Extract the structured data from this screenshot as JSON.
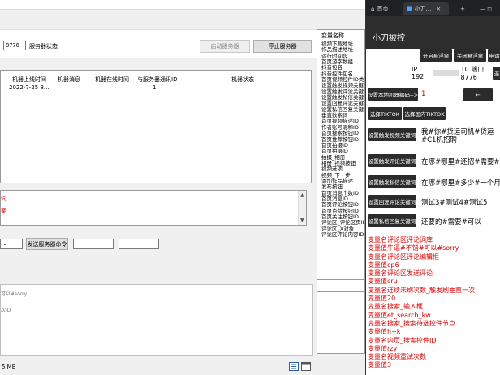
{
  "desktop": {
    "top_tabs": [
      "",
      "",
      ""
    ],
    "port_value": "8776",
    "server_status_label": "服务器状态",
    "start_server": "启动服务器",
    "stop_server": "停止服务器",
    "table": {
      "headers": [
        "机器上线时间",
        "机器消息",
        "机器在线时间",
        "与服务器通讯ID",
        "机器状态"
      ],
      "rows": [
        [
          "2022-7-25 8...",
          "",
          "",
          "1",
          ""
        ]
      ]
    },
    "log_lines": [
      "伺",
      "案"
    ],
    "send_command": "发送服务器命令",
    "bottom_text_1": "可以#sorry",
    "bottom_text_2": "次ID",
    "status_size": "5 MB"
  },
  "varlist": {
    "header": "变量名称",
    "items": [
      "视频下载地址",
      "作品描述地址",
      "运行时间段",
      "首页游字数组",
      "抖音包名",
      "抖音控件包名",
      "首页视频控件ID类",
      "设置触发视频关键",
      "设置触发评论关键",
      "设置触发私信关键",
      "设置回复评论关键",
      "设置私信回复关键",
      "垂直数索词",
      "首页视频描述ID",
      "作者账号昵称ID",
      "首页搜索按钮ID",
      "首页推荐按钮ID",
      "首页拍摄ID",
      "首页拍摄ID",
      "拍摄_相册",
      "相册_视频按钮",
      "视频选项",
      "视频_下一步",
      "添加作品描述",
      "发布按钮",
      "首页消息个数ID",
      "首页消息ID",
      "首页评论按钮ID",
      "首页点赞按钮ID",
      "首页关注按钮ID",
      "评论区_评论区页ID",
      "评论区_X对象",
      "评论区评论内容ID"
    ]
  },
  "phone": {
    "chrome_tabs": [
      "首页",
      "小刀...",
      "×"
    ],
    "app_title": "小刀被控",
    "buttons_row1": [
      "开启悬浮窗",
      "关闭悬浮窗",
      "申请"
    ],
    "ip_prefix": "IP 192",
    "ip_suffix": "10 端口 8776",
    "ip_button": "连",
    "set_machine_code": "设置本地机器编码-->",
    "machine_code": "1",
    "arrow_label": "←",
    "select_tiktok": "选择TIKTOK",
    "select_cn_tiktok": "选择国内TIKTOK",
    "kw_buttons": [
      {
        "label": "设置触发视频关键词",
        "value": "我#你#货运司机#货运#C1机招聘"
      },
      {
        "label": "设置触发评论关键词",
        "value": "在哪#哪里#还招#需要#多少"
      },
      {
        "label": "设置触发私信关键词",
        "value": "在哪#哪里#多少#一个月#"
      },
      {
        "label": "设置回复评论关键词",
        "value": "测试3#测试4#测试5"
      },
      {
        "label": "设置私信回复关键词",
        "value": "还要的#需要#可以"
      }
    ],
    "red_list": [
      "变量名评论区评论词库",
      "变量值牛逼#不错#可以#sorry",
      "变量名评论区评论编辑框",
      "变量值cp6",
      "变量名评论区发送评论",
      "变量值cru",
      "变量名连续未刷次数_触发刷垂直一次",
      "变量值20",
      "变量名搜索_输入框",
      "变量值et_search_kw",
      "变量名搜索_搜索待选控件节点",
      "变量值h+k",
      "变量名内页_搜索控件ID",
      "变量值rzy",
      "变量名视频重试次数",
      "变量值3"
    ]
  }
}
